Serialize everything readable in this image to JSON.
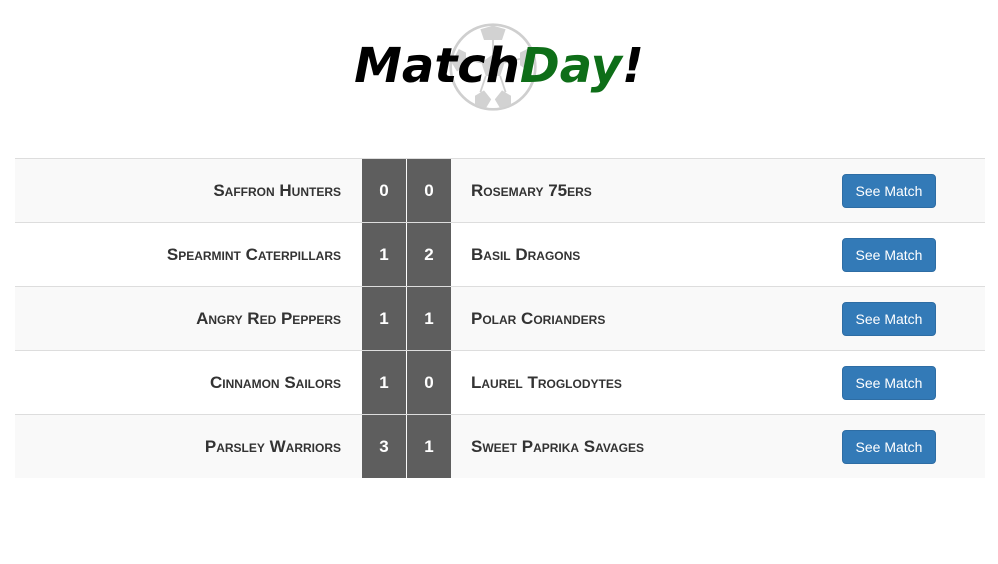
{
  "header": {
    "logo_word1": "Match",
    "logo_word2": "Day",
    "logo_word3": "!"
  },
  "matches": [
    {
      "home": "Saffron Hunters",
      "home_score": "0",
      "away_score": "0",
      "away": "Rosemary 75ers",
      "button": "See Match"
    },
    {
      "home": "Spearmint Caterpillars",
      "home_score": "1",
      "away_score": "2",
      "away": "Basil Dragons",
      "button": "See Match"
    },
    {
      "home": "Angry Red Peppers",
      "home_score": "1",
      "away_score": "1",
      "away": "Polar Corianders",
      "button": "See Match"
    },
    {
      "home": "Cinnamon Sailors",
      "home_score": "1",
      "away_score": "0",
      "away": "Laurel Troglodytes",
      "button": "See Match"
    },
    {
      "home": "Parsley Warriors",
      "home_score": "3",
      "away_score": "1",
      "away": "Sweet Paprika Savages",
      "button": "See Match"
    }
  ],
  "colors": {
    "logo_green": "#0e6e18",
    "score_bg": "#5e5e5e",
    "button_bg": "#337ab7"
  },
  "icons": {
    "logo_background": "soccer-ball-icon"
  }
}
